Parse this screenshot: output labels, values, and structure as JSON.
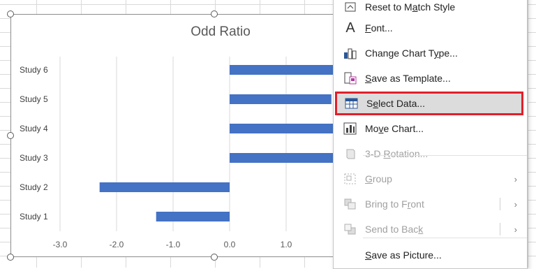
{
  "chart": {
    "title": "Odd Ratio"
  },
  "chart_data": {
    "type": "bar",
    "orientation": "horizontal",
    "title": "Odd Ratio",
    "categories": [
      "Study 1",
      "Study 2",
      "Study 3",
      "Study 4",
      "Study 5",
      "Study 6"
    ],
    "values": [
      -1.3,
      -2.3,
      2.0,
      2.0,
      1.8,
      2.0
    ],
    "x_ticks": [
      "-3.0",
      "-2.0",
      "-1.0",
      "0.0",
      "1.0"
    ],
    "xlim": [
      -3.0,
      2.0
    ],
    "grid": true,
    "bar_color": "#4472c4",
    "grid_color": "#d9d9d9"
  },
  "menu": {
    "items": [
      {
        "label_pre": "Reset to M",
        "label_ul": "a",
        "label_post": "tch Style",
        "icon": "reset-style-icon",
        "disabled": false
      },
      {
        "label_pre": "",
        "label_ul": "F",
        "label_post": "ont...",
        "icon": "font-icon",
        "disabled": false
      },
      {
        "label_pre": "Change Chart T",
        "label_ul": "y",
        "label_post": "pe...",
        "icon": "change-chart-type-icon",
        "disabled": false
      },
      {
        "label_pre": "",
        "label_ul": "S",
        "label_post": "ave as Template...",
        "icon": "save-template-icon",
        "disabled": false
      },
      {
        "label_pre": "S",
        "label_ul": "e",
        "label_post": "lect Data...",
        "icon": "select-data-icon",
        "disabled": false,
        "highlighted": true
      },
      {
        "label_pre": "Mo",
        "label_ul": "v",
        "label_post": "e Chart...",
        "icon": "move-chart-icon",
        "disabled": false
      },
      {
        "label_pre": "3-D ",
        "label_ul": "R",
        "label_post": "otation...",
        "icon": "rotation-3d-icon",
        "disabled": true
      },
      {
        "label_pre": "",
        "label_ul": "G",
        "label_post": "roup",
        "icon": "group-icon",
        "disabled": true,
        "submenu": true
      },
      {
        "label_pre": "Bring to F",
        "label_ul": "r",
        "label_post": "ont",
        "icon": "bring-to-front-icon",
        "disabled": true,
        "submenu": true
      },
      {
        "label_pre": "Send to Bac",
        "label_ul": "k",
        "label_post": "",
        "icon": "send-to-back-icon",
        "disabled": true,
        "submenu": true
      },
      {
        "label_pre": "",
        "label_ul": "S",
        "label_post": "ave as Picture...",
        "icon": "save-picture-icon",
        "disabled": false
      }
    ],
    "arrow_glyph": "›",
    "highlight_color": "#e0202a"
  }
}
